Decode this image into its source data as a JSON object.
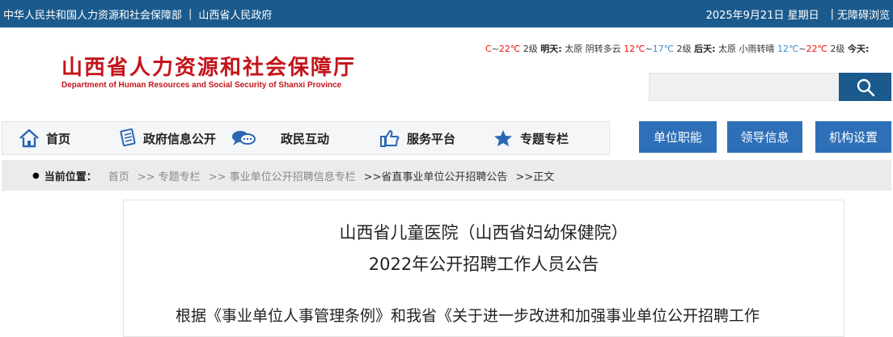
{
  "topbar": {
    "link1": "中华人民共和国人力资源和社会保障部",
    "separator": "|",
    "link2": "山西省人民政府",
    "date": "2025年9月21日 星期日",
    "accessibility": "无障碍浏览"
  },
  "header": {
    "title_cn": "山西省人力资源和社会保障厅",
    "title_en": "Department of Human Resources and Social Security of Shanxi Province"
  },
  "weather": {
    "w1_low_partial": "C",
    "w1_sep": "~",
    "w1_high": "22℃",
    "w1_wind": "2级",
    "w2_day": "明天:",
    "w2_city": "太原",
    "w2_cond": "阴转多云",
    "w2_high": "12℃",
    "w2_sep": "~",
    "w2_low": "17℃",
    "w2_wind": "2级",
    "w3_day": "后天:",
    "w3_city": "太原",
    "w3_cond": "小雨转晴",
    "w3_low": "12℃",
    "w3_sep": "~",
    "w3_high": "22℃",
    "w3_wind": "2级",
    "w4_day": "今天:"
  },
  "search": {
    "placeholder": "",
    "icon": "search-icon"
  },
  "nav": {
    "items": [
      {
        "label": "首页",
        "icon": "home-icon"
      },
      {
        "label": "政府信息公开",
        "icon": "document-icon"
      },
      {
        "label": "政民互动",
        "icon": "chat-icon"
      },
      {
        "label": "服务平台",
        "icon": "thumbs-up-icon"
      },
      {
        "label": "专题专栏",
        "icon": "star-icon"
      }
    ]
  },
  "quick_links": [
    {
      "label": "单位职能"
    },
    {
      "label": "领导信息"
    },
    {
      "label": "机构设置"
    }
  ],
  "breadcrumb": {
    "bullet": "●",
    "current_label": "当前位置：",
    "items": [
      "首页",
      ">> 专题专栏",
      ">> 事业单位公开招聘信息专栏",
      ">>省直事业单位公开招聘公告",
      ">>正文"
    ]
  },
  "article": {
    "title_line1": "山西省儿童医院（山西省妇幼保健院）",
    "title_line2": "2022年公开招聘工作人员公告",
    "paragraph": "根据《事业单位人事管理条例》和我省《关于进一步改进和加强事业单位公开招聘工作"
  },
  "colors": {
    "brand_blue": "#1b5a8c",
    "button_blue": "#2e70b8",
    "brand_red": "#c4141a",
    "temp_hot": "#e11111",
    "temp_cold": "#3a8fd0"
  }
}
